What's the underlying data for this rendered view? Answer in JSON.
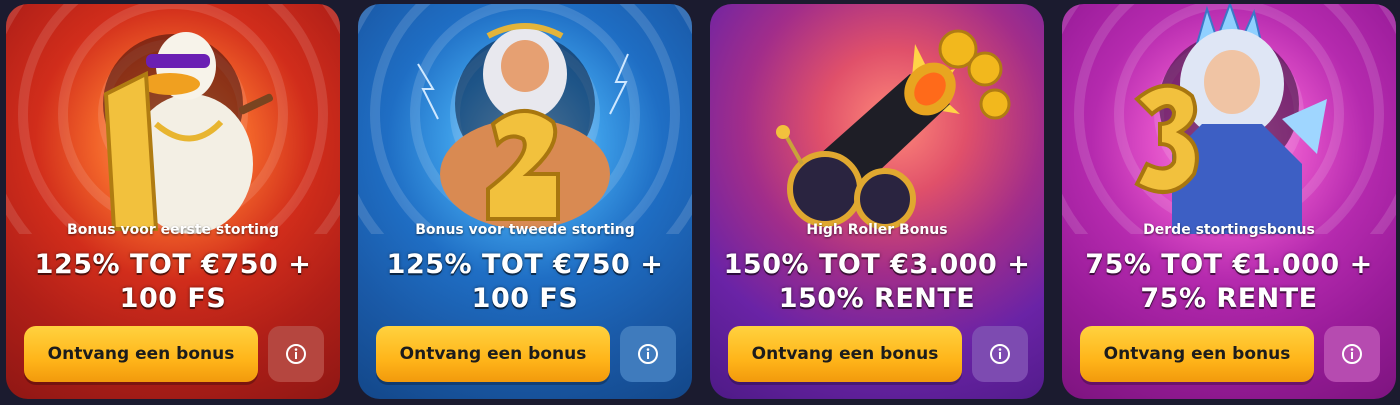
{
  "cards": [
    {
      "subtitle": "Bonus voor eerste storting",
      "headline_line1": "125% TOT €750 +",
      "headline_line2": "100 FS",
      "cta_label": "Ontvang een bonus",
      "numeral": "1",
      "illustration": "duck-with-sunglasses-and-golden-1",
      "bg_color": "#c8231a",
      "info_button_color": "#b5463f"
    },
    {
      "subtitle": "Bonus voor tweede storting",
      "headline_line1": "125% TOT €750 +",
      "headline_line2": "100 FS",
      "cta_label": "Ontvang een bonus",
      "numeral": "2",
      "illustration": "zeus-with-golden-2",
      "bg_color": "#1f6ec4",
      "info_button_color": "#3f7bbd"
    },
    {
      "subtitle": "High Roller Bonus",
      "headline_line1": "150% TOT €3.000 +",
      "headline_line2": "150% RENTE",
      "cta_label": "Ontvang een bonus",
      "numeral": "",
      "illustration": "cannon-firing-gold-coins",
      "bg_color": "#6a23a6",
      "info_button_color": "#7d4bb1"
    },
    {
      "subtitle": "Derde stortingsbonus",
      "headline_line1": "75% TOT €1.000 +",
      "headline_line2": "75% RENTE",
      "cta_label": "Ontvang een bonus",
      "numeral": "3",
      "illustration": "ice-queen-with-golden-3",
      "bg_color": "#a51fa6",
      "info_button_color": "#b64bb0"
    }
  ],
  "colors": {
    "cta_gold": "#ffc02a",
    "page_bg": "#1b1b2f"
  }
}
